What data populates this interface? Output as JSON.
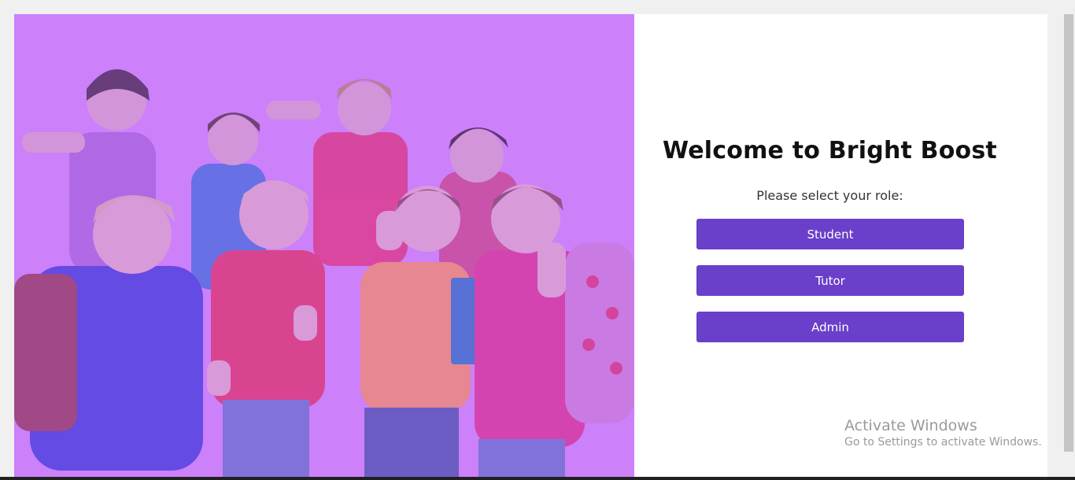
{
  "main": {
    "title": "Welcome to Bright Boost",
    "prompt": "Please select your role:",
    "roles": [
      {
        "label": "Student"
      },
      {
        "label": "Tutor"
      },
      {
        "label": "Admin"
      }
    ]
  },
  "hero": {
    "image_description": "Group of smiling schoolchildren giving thumbs up",
    "overlay_color": "#cc80fa"
  },
  "watermark": {
    "title": "Activate Windows",
    "subtitle": "Go to Settings to activate Windows."
  },
  "colors": {
    "button": "#6a3fc9",
    "hero_overlay": "#cc80fa",
    "page_bg": "#f0f0f0"
  }
}
